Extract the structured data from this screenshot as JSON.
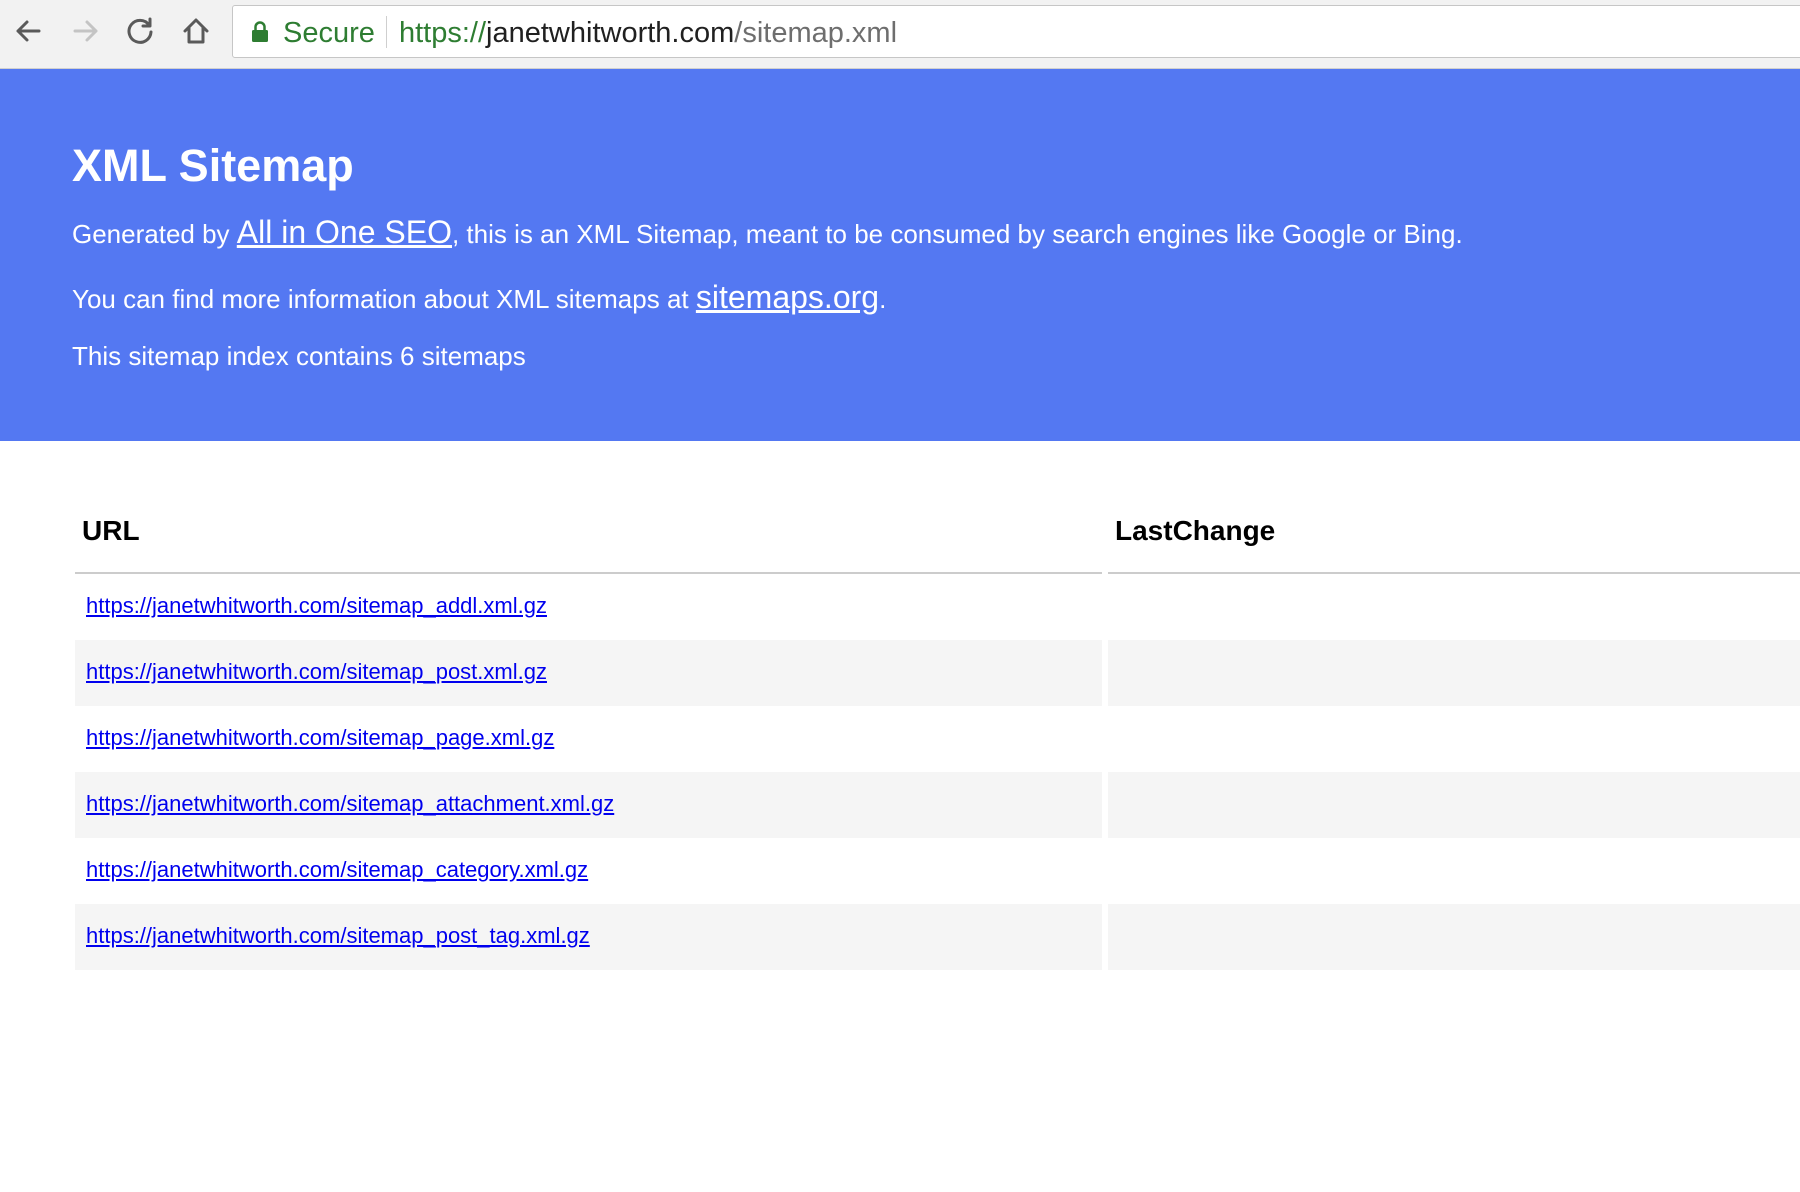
{
  "browser": {
    "secure_label": "Secure",
    "url_scheme": "https://",
    "url_host": "janetwhitworth.com",
    "url_path": "/sitemap.xml"
  },
  "header": {
    "title": "XML Sitemap",
    "generated_prefix": "Generated by ",
    "generator_link": "All in One SEO",
    "generated_suffix": ", this is an XML Sitemap, meant to be consumed by search engines like Google or Bing.",
    "info_prefix": "You can find more information about XML sitemaps at ",
    "info_link": "sitemaps.org",
    "info_suffix": ".",
    "count_text": "This sitemap index contains 6 sitemaps",
    "background_color": "#5478f2"
  },
  "table": {
    "col_url": "URL",
    "col_lastchange": "LastChange",
    "rows": [
      {
        "url": "https://janetwhitworth.com/sitemap_addl.xml.gz",
        "lastchange": ""
      },
      {
        "url": "https://janetwhitworth.com/sitemap_post.xml.gz",
        "lastchange": ""
      },
      {
        "url": "https://janetwhitworth.com/sitemap_page.xml.gz",
        "lastchange": ""
      },
      {
        "url": "https://janetwhitworth.com/sitemap_attachment.xml.gz",
        "lastchange": ""
      },
      {
        "url": "https://janetwhitworth.com/sitemap_category.xml.gz",
        "lastchange": ""
      },
      {
        "url": "https://janetwhitworth.com/sitemap_post_tag.xml.gz",
        "lastchange": ""
      }
    ]
  }
}
